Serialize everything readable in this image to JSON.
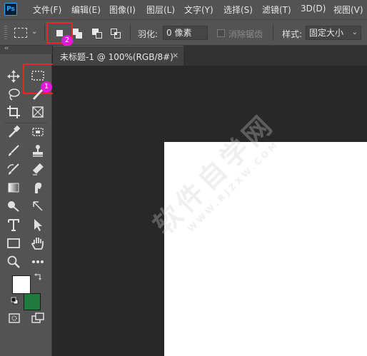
{
  "app": {
    "logo_text": "Ps"
  },
  "menu": [
    "文件(F)",
    "编辑(E)",
    "图像(I)",
    "图层(L)",
    "文字(Y)",
    "选择(S)",
    "滤镜(T)",
    "3D(D)",
    "视图(V)"
  ],
  "options_bar": {
    "feather_label": "羽化:",
    "feather_value": "0 像素",
    "antialias_label": "消除锯齿",
    "style_label": "样式:",
    "style_value": "固定大小",
    "selection_modes": [
      "new-selection",
      "add-to-selection",
      "subtract-from-selection",
      "intersect-with-selection"
    ]
  },
  "annotations": {
    "badge1": "1",
    "badge2": "2",
    "highlight_color": "#e8262b",
    "badge_color": "#e01ad8"
  },
  "document": {
    "tab_label": "未标题-1 @ 100%(RGB/8#)",
    "close_glyph": "×",
    "canvas_color": "#ffffff"
  },
  "watermark": {
    "main": "软件自学网",
    "sub": "WWW.RJZXW.COM"
  },
  "colors": {
    "foreground": "#ffffff",
    "background": "#1f7a3e"
  },
  "icons": [
    "move-icon",
    "rect-marquee-icon",
    "lasso-icon",
    "brush-icon",
    "crop-icon",
    "frame-icon",
    "eyedropper-icon",
    "healing-icon",
    "paintbrush-icon",
    "stamp-icon",
    "history-brush-icon",
    "eraser-icon",
    "gradient-icon",
    "smudge-icon",
    "dodge-icon",
    "pen-icon",
    "type-icon",
    "path-select-icon",
    "rectangle-icon",
    "hand-icon",
    "zoom-icon",
    "more-icon",
    "quick-mask-icon",
    "screen-mode-icon"
  ]
}
